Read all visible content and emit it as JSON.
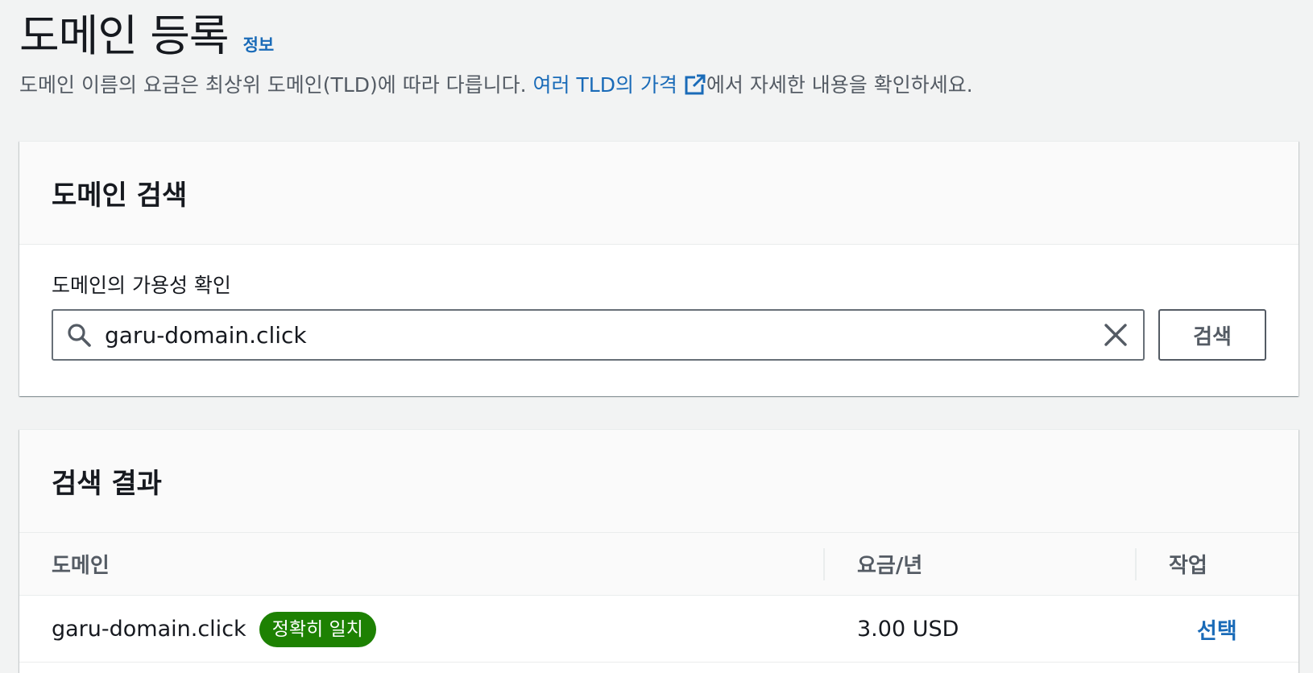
{
  "header": {
    "title": "도메인 등록",
    "info_link": "정보",
    "description_pre": "도메인 이름의 요금은 최상위 도메인(TLD)에 따라 다릅니다. ",
    "description_link": "여러 TLD의 가격",
    "description_post": "에서 자세한 내용을 확인하세요."
  },
  "search_panel": {
    "title": "도메인 검색",
    "field_label": "도메인의 가용성 확인",
    "input_value": "garu-domain.click",
    "search_button": "검색"
  },
  "results_panel": {
    "title": "검색 결과",
    "columns": [
      "도메인",
      "요금/년",
      "작업"
    ],
    "rows": [
      {
        "domain": "garu-domain.click",
        "badge": "정확히 일치",
        "price": "3.00 USD",
        "action": "선택"
      }
    ]
  },
  "colors": {
    "link": "#1a6bb8",
    "badge_green": "#1d8102",
    "background": "#f2f3f3"
  },
  "icons": [
    "external-link-icon",
    "search-icon",
    "clear-icon"
  ]
}
